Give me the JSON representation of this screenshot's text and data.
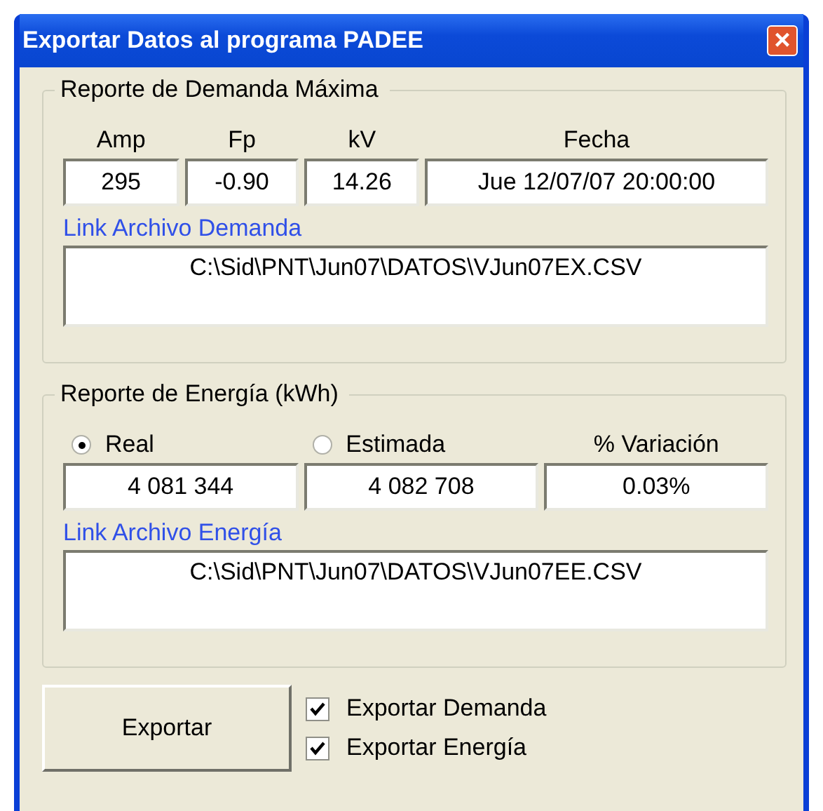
{
  "window": {
    "title": "Exportar Datos al programa PADEE",
    "close": "×"
  },
  "demanda": {
    "title": "Reporte de Demanda Máxima",
    "fields": [
      {
        "label": "Amp",
        "value": "295"
      },
      {
        "label": "Fp",
        "value": "-0.90"
      },
      {
        "label": "kV",
        "value": "14.26"
      },
      {
        "label": "Fecha",
        "value": "Jue 12/07/07 20:00:00"
      }
    ],
    "link_label": "Link Archivo Demanda",
    "link_value": "C:\\Sid\\PNT\\Jun07\\DATOS\\VJun07EX.CSV"
  },
  "energia": {
    "title": "Reporte de Energía (kWh)",
    "options": [
      {
        "label": "Real",
        "selected": true,
        "value": "4 081 344"
      },
      {
        "label": "Estimada",
        "selected": false,
        "value": "4 082 708"
      }
    ],
    "variation": {
      "label": "% Variación",
      "value": "0.03%"
    },
    "link_label": "Link Archivo Energía",
    "link_value": "C:\\Sid\\PNT\\Jun07\\DATOS\\VJun07EE.CSV"
  },
  "export_button": "Exportar",
  "checks": [
    {
      "label": "Exportar Demanda",
      "checked": true
    },
    {
      "label": "Exportar Energía",
      "checked": true
    }
  ]
}
